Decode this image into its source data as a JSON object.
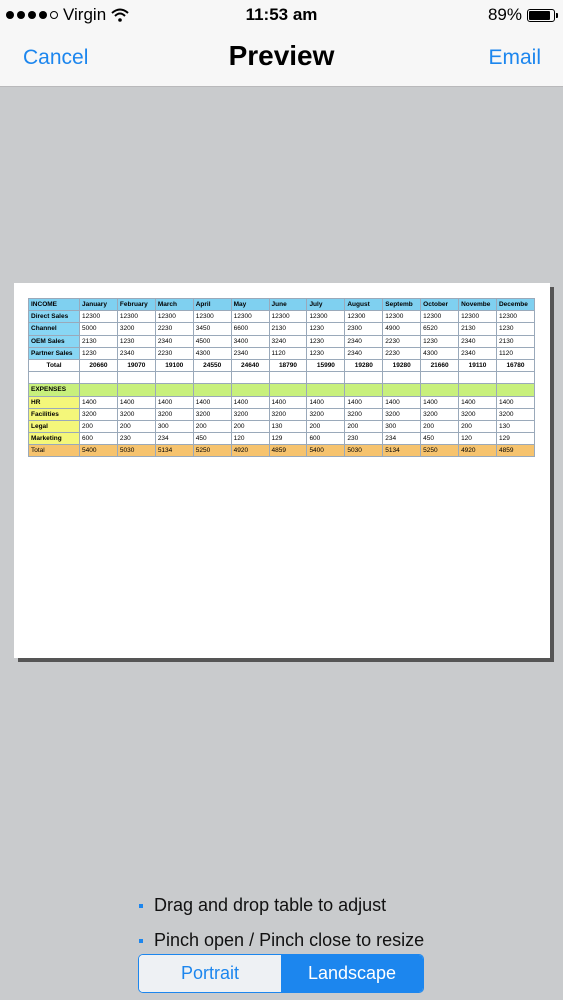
{
  "status": {
    "carrier": "Virgin",
    "time": "11:53 am",
    "battery": "89%",
    "battery_level": 0.89
  },
  "nav": {
    "cancel": "Cancel",
    "title": "Preview",
    "email": "Email"
  },
  "sheet": {
    "income_header": [
      "INCOME",
      "January",
      "February",
      "March",
      "April",
      "May",
      "June",
      "July",
      "August",
      "Septemb",
      "October",
      "Novembe",
      "Decembe"
    ],
    "income_rows": [
      [
        "Direct Sales",
        "12300",
        "12300",
        "12300",
        "12300",
        "12300",
        "12300",
        "12300",
        "12300",
        "12300",
        "12300",
        "12300",
        "12300"
      ],
      [
        "Channel",
        "5000",
        "3200",
        "2230",
        "3450",
        "6600",
        "2130",
        "1230",
        "2300",
        "4900",
        "6520",
        "2130",
        "1230"
      ],
      [
        "OEM Sales",
        "2130",
        "1230",
        "2340",
        "4500",
        "3400",
        "3240",
        "1230",
        "2340",
        "2230",
        "1230",
        "2340",
        "2130"
      ],
      [
        "Partner Sales",
        "1230",
        "2340",
        "2230",
        "4300",
        "2340",
        "1120",
        "1230",
        "2340",
        "2230",
        "4300",
        "2340",
        "1120"
      ]
    ],
    "income_total": [
      "Total",
      "20660",
      "19070",
      "19100",
      "24550",
      "24640",
      "18790",
      "15990",
      "19280",
      "19280",
      "21660",
      "19110",
      "16780"
    ],
    "expenses_label": "EXPENSES",
    "expense_rows": [
      [
        "HR",
        "1400",
        "1400",
        "1400",
        "1400",
        "1400",
        "1400",
        "1400",
        "1400",
        "1400",
        "1400",
        "1400",
        "1400"
      ],
      [
        "Facilities",
        "3200",
        "3200",
        "3200",
        "3200",
        "3200",
        "3200",
        "3200",
        "3200",
        "3200",
        "3200",
        "3200",
        "3200"
      ],
      [
        "Legal",
        "200",
        "200",
        "300",
        "200",
        "200",
        "130",
        "200",
        "200",
        "300",
        "200",
        "200",
        "130"
      ],
      [
        "Marketing",
        "600",
        "230",
        "234",
        "450",
        "120",
        "129",
        "600",
        "230",
        "234",
        "450",
        "120",
        "129"
      ]
    ],
    "expense_total": [
      "Total",
      "5400",
      "5030",
      "5134",
      "5250",
      "4920",
      "4859",
      "5400",
      "5030",
      "5134",
      "5250",
      "4920",
      "4859"
    ]
  },
  "tips": [
    "Drag and drop table to adjust",
    "Pinch open / Pinch close to resize"
  ],
  "orientation": {
    "portrait": "Portrait",
    "landscape": "Landscape",
    "selected": "Landscape"
  },
  "colors": {
    "accent": "#1c86ee",
    "income_header": "#7fd0f0",
    "expenses_header": "#c8f07c",
    "expense_label": "#f4f77a",
    "expense_total": "#f6c36e"
  }
}
